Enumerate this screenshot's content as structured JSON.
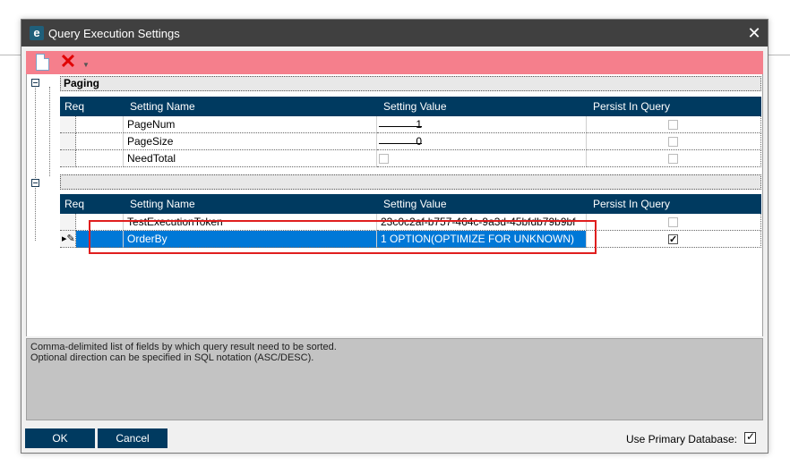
{
  "window": {
    "title": "Query Execution Settings",
    "app_icon": "e"
  },
  "toolbar": {
    "new_icon": "new-document-icon",
    "delete_icon": "delete-icon",
    "dropdown_icon": "dropdown-arrow-icon"
  },
  "columns": {
    "req": "Req",
    "name": "Setting Name",
    "value": "Setting Value",
    "persist": "Persist In Query"
  },
  "band1": {
    "title": "Paging",
    "rows": [
      {
        "name": "PageNum",
        "value": "1",
        "persist": false
      },
      {
        "name": "PageSize",
        "value": "0",
        "persist": false
      },
      {
        "name": "NeedTotal",
        "value": "",
        "value_checkbox": false,
        "persist": false
      }
    ]
  },
  "band2": {
    "title": "",
    "rows": [
      {
        "name": "TestExecutionToken",
        "value": "23c0c2af-b757-464c-9a3d-45bfdb79b9bf",
        "persist": false
      },
      {
        "name": "OrderBy",
        "value": "1 OPTION(OPTIMIZE FOR UNKNOWN)",
        "persist": true
      }
    ]
  },
  "description": {
    "line1": "Comma-delimited list of fields by which query result need to be sorted.",
    "line2": "Optional direction can be specified in SQL notation (ASC/DESC)."
  },
  "buttons": {
    "ok": "OK",
    "cancel": "Cancel"
  },
  "footer": {
    "use_primary_label": "Use Primary Database:",
    "use_primary_checked": true
  },
  "colors": {
    "accent": "#003a60",
    "toolbar": "#f57f8c",
    "selection": "#0078d7",
    "highlight": "#e01e1e"
  }
}
